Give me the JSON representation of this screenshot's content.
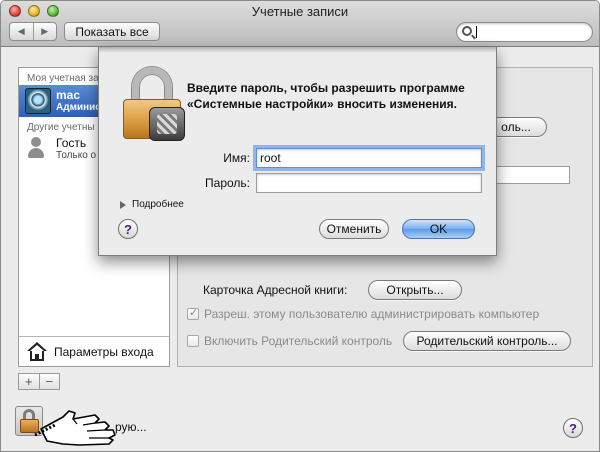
{
  "window": {
    "title": "Учетные записи"
  },
  "toolbar": {
    "back": "◀",
    "forward": "▶",
    "show_all": "Показать все",
    "search_value": ""
  },
  "sidebar": {
    "my_account_header": "Моя учетная за",
    "user": {
      "name": "mac",
      "role": "Админис"
    },
    "other_header": "Другие учетны",
    "guest": {
      "name": "Гость",
      "status": "Только о"
    },
    "login_options": "Параметры входа",
    "add": "+",
    "remove": "−"
  },
  "pane": {
    "partial_button": "оль...",
    "address_card_label": "Карточка Адресной книги:",
    "open_button": "Открыть...",
    "allow_admin": {
      "label": "Разреш. этому пользователю администрировать компьютер",
      "checked": true
    },
    "parental": {
      "label": "Включить Родительский контроль",
      "checked": false
    },
    "parental_button": "Родительский контроль..."
  },
  "bottom": {
    "lock_text": "рую...",
    "help": "?"
  },
  "sheet": {
    "message": "Введите пароль, чтобы разрешить программе «Системные настройки» вносить изменения.",
    "name_label": "Имя:",
    "name_value": "root",
    "password_label": "Пароль:",
    "password_value": "",
    "details": "Подробнее",
    "help": "?",
    "cancel": "Отменить",
    "ok": "OK"
  },
  "colors": {
    "ok_button": "#76aef0",
    "selection": "#2c5fb8",
    "lock_body": "#d8993e"
  }
}
